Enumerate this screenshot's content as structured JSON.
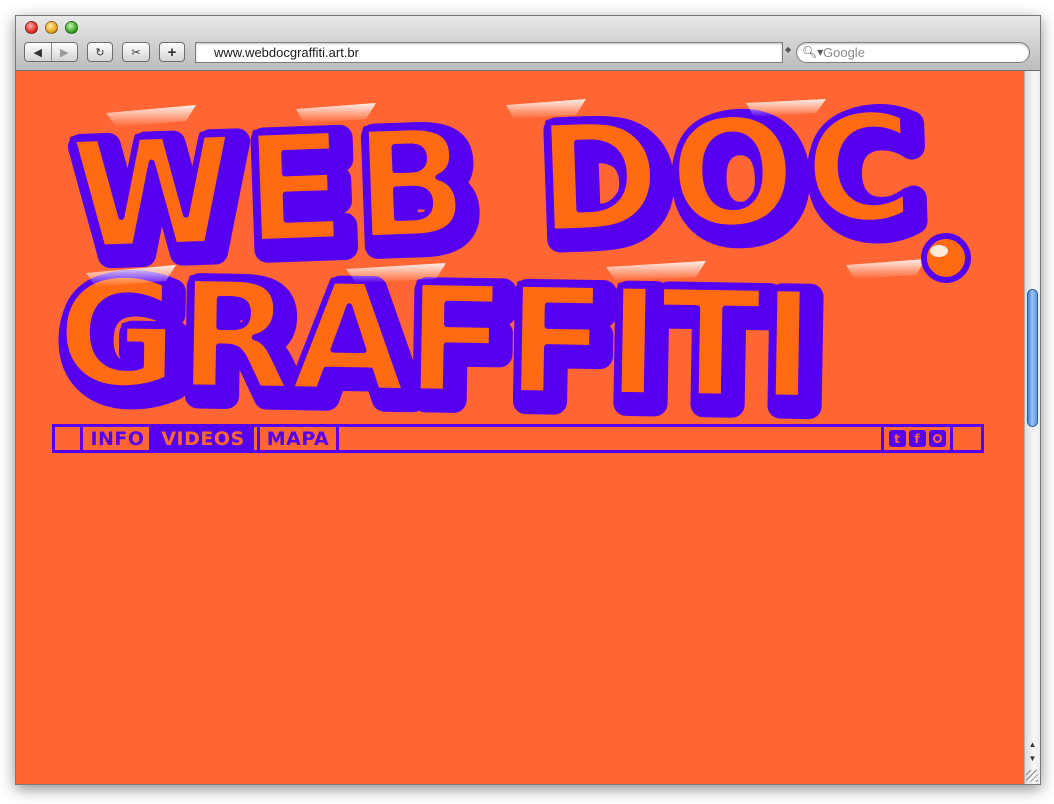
{
  "browser": {
    "url": "www.webdocgraffiti.art.br",
    "search_placeholder": "Google",
    "back_glyph": "◀",
    "forward_glyph": "▶",
    "reload_glyph": "↻",
    "clip_glyph": "✂",
    "add_glyph": "+"
  },
  "site": {
    "logo_text": "WEBDOC GRAFFITI",
    "nav": {
      "items": [
        "INFO",
        "VIDEOS",
        "MAPA"
      ],
      "active_index": 1
    },
    "social": [
      "twitter-icon",
      "facebook-icon",
      "instagram-icon"
    ],
    "colors": {
      "background": "#ff6633",
      "accent": "#5500ee",
      "logo_fill": "#ff6a13"
    }
  }
}
